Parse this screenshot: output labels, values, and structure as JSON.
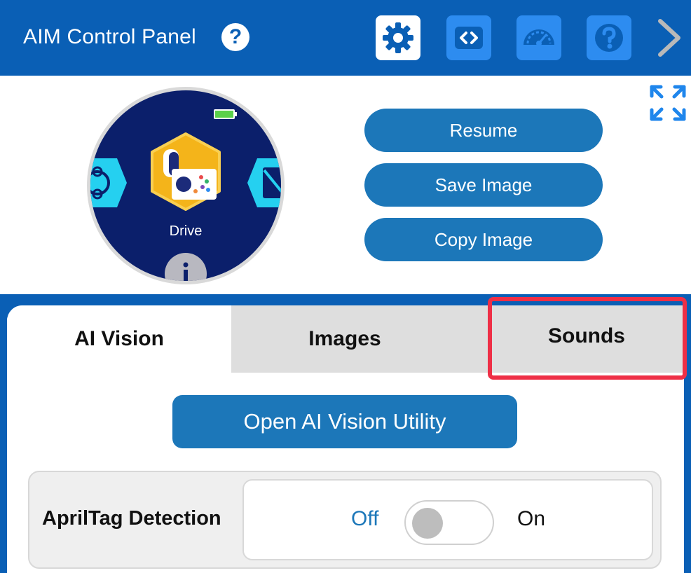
{
  "header": {
    "title": "AIM Control Panel",
    "help_glyph": "?",
    "toolbar_icons": [
      "gear-icon",
      "code-icon",
      "dashboard-icon",
      "help-icon",
      "chevron-right-icon"
    ]
  },
  "brain_screen": {
    "active_app": "Drive",
    "icons": [
      "battery-icon",
      "drive-app-icon",
      "info-icon"
    ]
  },
  "actions": {
    "resume": "Resume",
    "save_image": "Save Image",
    "copy_image": "Copy Image"
  },
  "tabs": [
    {
      "label": "AI Vision",
      "selected": true
    },
    {
      "label": "Images",
      "selected": false
    },
    {
      "label": "Sounds",
      "selected": false
    }
  ],
  "ai_vision": {
    "open_utility": "Open AI Vision Utility",
    "apriltag": {
      "label": "AprilTag Detection",
      "off_label": "Off",
      "on_label": "On",
      "state": "Off"
    }
  },
  "colors": {
    "header_blue": "#0a5fb5",
    "button_blue": "#1c77b9",
    "highlight_red": "#ee2f46",
    "brain_screen": "#0b1f6b"
  }
}
